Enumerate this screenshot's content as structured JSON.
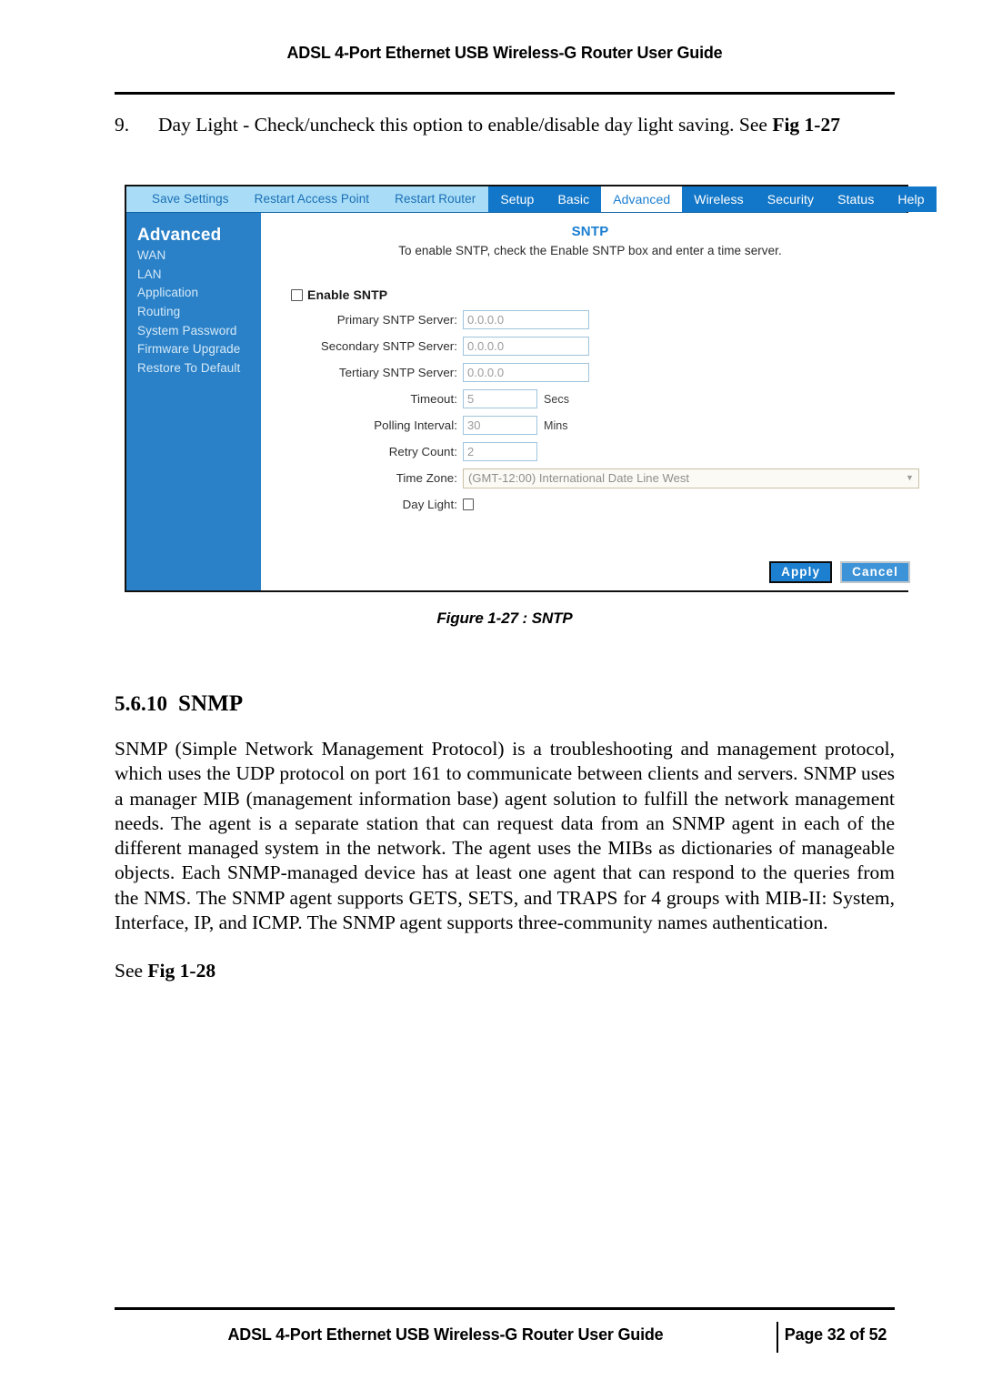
{
  "header": {
    "title": "ADSL 4-Port Ethernet USB Wireless-G Router User Guide"
  },
  "numbered_item": {
    "number": "9.",
    "text_before": "Day Light - Check/uncheck this option to enable/disable day light saving. See ",
    "text_bold": "Fig 1-27"
  },
  "router_ui": {
    "nav_left": [
      {
        "label": "Save Settings",
        "name": "save-settings"
      },
      {
        "label": "Restart Access Point",
        "name": "restart-access-point"
      },
      {
        "label": "Restart Router",
        "name": "restart-router"
      }
    ],
    "nav_tabs": [
      {
        "label": "Setup",
        "active": false
      },
      {
        "label": "Basic",
        "active": false
      },
      {
        "label": "Advanced",
        "active": true
      },
      {
        "label": "Wireless",
        "active": false
      },
      {
        "label": "Security",
        "active": false
      },
      {
        "label": "Status",
        "active": false
      },
      {
        "label": "Help",
        "active": false
      }
    ],
    "sidebar": {
      "title": "Advanced",
      "items": [
        {
          "label": "WAN"
        },
        {
          "label": "LAN"
        },
        {
          "label": "Application"
        },
        {
          "label": "Routing"
        },
        {
          "label": "System Password"
        },
        {
          "label": "Firmware Upgrade"
        },
        {
          "label": "Restore To Default"
        }
      ]
    },
    "panel": {
      "title": "SNTP",
      "description": "To enable SNTP, check the Enable SNTP box and enter a time server.",
      "enable_label": "Enable SNTP",
      "fields": [
        {
          "label": "Primary SNTP Server:",
          "value": "0.0.0.0",
          "unit": ""
        },
        {
          "label": "Secondary SNTP Server:",
          "value": "0.0.0.0",
          "unit": ""
        },
        {
          "label": "Tertiary SNTP Server:",
          "value": "0.0.0.0",
          "unit": ""
        },
        {
          "label": "Timeout:",
          "value": "5",
          "unit": "Secs"
        },
        {
          "label": "Polling Interval:",
          "value": "30",
          "unit": "Mins"
        },
        {
          "label": "Retry Count:",
          "value": "2",
          "unit": ""
        }
      ],
      "timezone_label": "Time Zone:",
      "timezone_value": "(GMT-12:00) International Date Line West",
      "daylight_label": "Day Light:",
      "apply_label": "Apply",
      "cancel_label": "Cancel"
    },
    "colors": {
      "nav_bar": "#1277c8",
      "nav_left_bg": "#a9ddf7",
      "sidebar": "#2a81c8",
      "title_blue": "#1a7ed0",
      "apply_button": "#1c7fd0",
      "cancel_button": "#3d93d8"
    }
  },
  "figure_caption": "Figure 1-27 : SNTP",
  "section": {
    "number": "5.6.10",
    "title": "SNMP",
    "paragraph": "SNMP (Simple Network Management Protocol) is a troubleshooting and management protocol, which uses the UDP protocol on port 161 to communicate between clients and servers.  SNMP uses a manager MIB (management information base) agent solution to fulfill the network management needs. The agent is a separate station that can request data from an SNMP agent in each of the different managed system in the network. The agent uses the MIBs as dictionaries of manageable objects. Each SNMP-managed device has at least one agent that can respond to the queries from the NMS. The SNMP agent supports GETS, SETS, and TRAPS for 4 groups with MIB-II: System, Interface, IP, and ICMP. The SNMP agent supports three-community names authentication.",
    "see_fig_before": "See ",
    "see_fig_bold": "Fig 1-28"
  },
  "footer": {
    "title": "ADSL 4-Port Ethernet USB Wireless-G Router User Guide",
    "page": "Page 32 of 52"
  }
}
